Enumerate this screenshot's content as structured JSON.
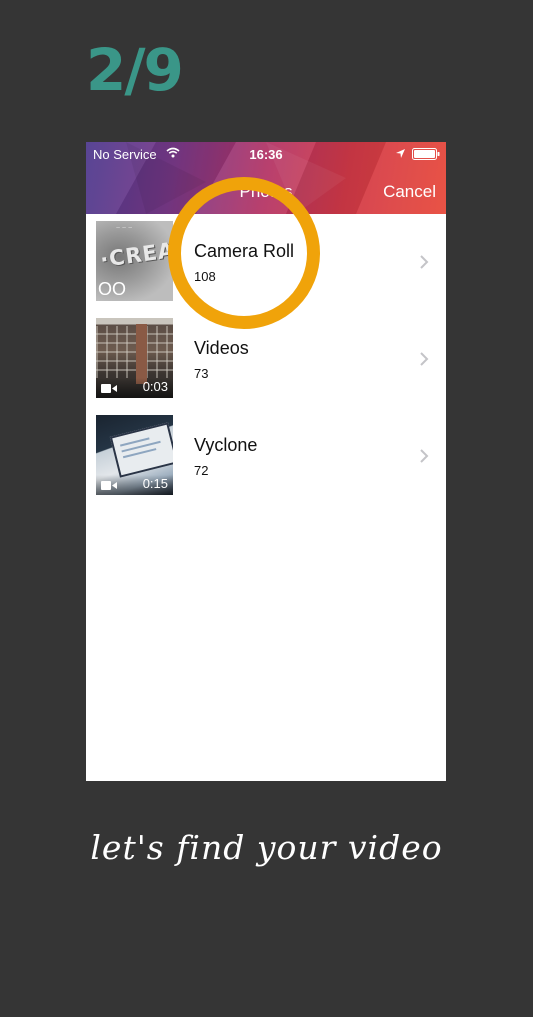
{
  "tutorial": {
    "step": "2/9",
    "caption": "let's find your video",
    "highlight_color": "#f0a30a"
  },
  "status_bar": {
    "carrier": "No Service",
    "time": "16:36",
    "icons": [
      "wifi-icon",
      "location-icon",
      "battery-icon"
    ]
  },
  "nav_bar": {
    "title": "Photos",
    "cancel_label": "Cancel"
  },
  "albums": [
    {
      "name": "Camera Roll",
      "count": "108",
      "thumbnail": "camera-roll-thumbnail",
      "duration": ""
    },
    {
      "name": "Videos",
      "count": "73",
      "thumbnail": "videos-thumbnail",
      "duration": "0:03"
    },
    {
      "name": "Vyclone",
      "count": "72",
      "thumbnail": "vyclone-thumbnail",
      "duration": "0:15"
    }
  ],
  "colors": {
    "background": "#353535",
    "step_counter": "#3a9688",
    "list_background": "#ffffff"
  }
}
